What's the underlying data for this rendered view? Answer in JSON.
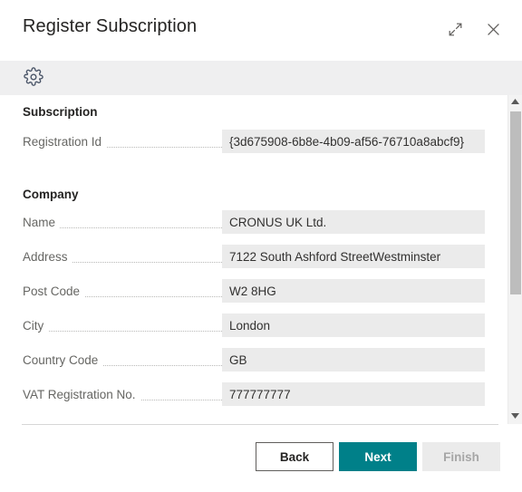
{
  "window": {
    "title": "Register Subscription",
    "expand_icon": "expand-diagonal-icon",
    "close_icon": "close-icon"
  },
  "toolbar": {
    "settings_icon": "gear-icon"
  },
  "colors": {
    "accent": "#008089",
    "field_background": "#ebebeb",
    "toolbar_background": "#efeff0",
    "label_text": "#666663",
    "disabled_text": "#a6a6a6"
  },
  "sections": [
    {
      "title": "Subscription",
      "fields": [
        {
          "label": "Registration Id",
          "value": "{3d675908-6b8e-4b09-af56-76710a8abcf9}"
        }
      ]
    },
    {
      "title": "Company",
      "fields": [
        {
          "label": "Name",
          "value": "CRONUS UK Ltd."
        },
        {
          "label": "Address",
          "value": "7122 South Ashford StreetWestminster"
        },
        {
          "label": "Post Code",
          "value": "W2 8HG"
        },
        {
          "label": "City",
          "value": "London"
        },
        {
          "label": "Country Code",
          "value": "GB"
        },
        {
          "label": "VAT Registration No.",
          "value": "777777777"
        }
      ]
    }
  ],
  "scrollbar": {
    "up_arrow": "caret-up-icon",
    "down_arrow": "caret-down-icon",
    "thumb_fraction": "61%"
  },
  "footer": {
    "buttons": [
      {
        "label": "Back",
        "style": "secondary",
        "disabled": false
      },
      {
        "label": "Next",
        "style": "primary",
        "disabled": false
      },
      {
        "label": "Finish",
        "style": "disabled",
        "disabled": true
      }
    ]
  }
}
